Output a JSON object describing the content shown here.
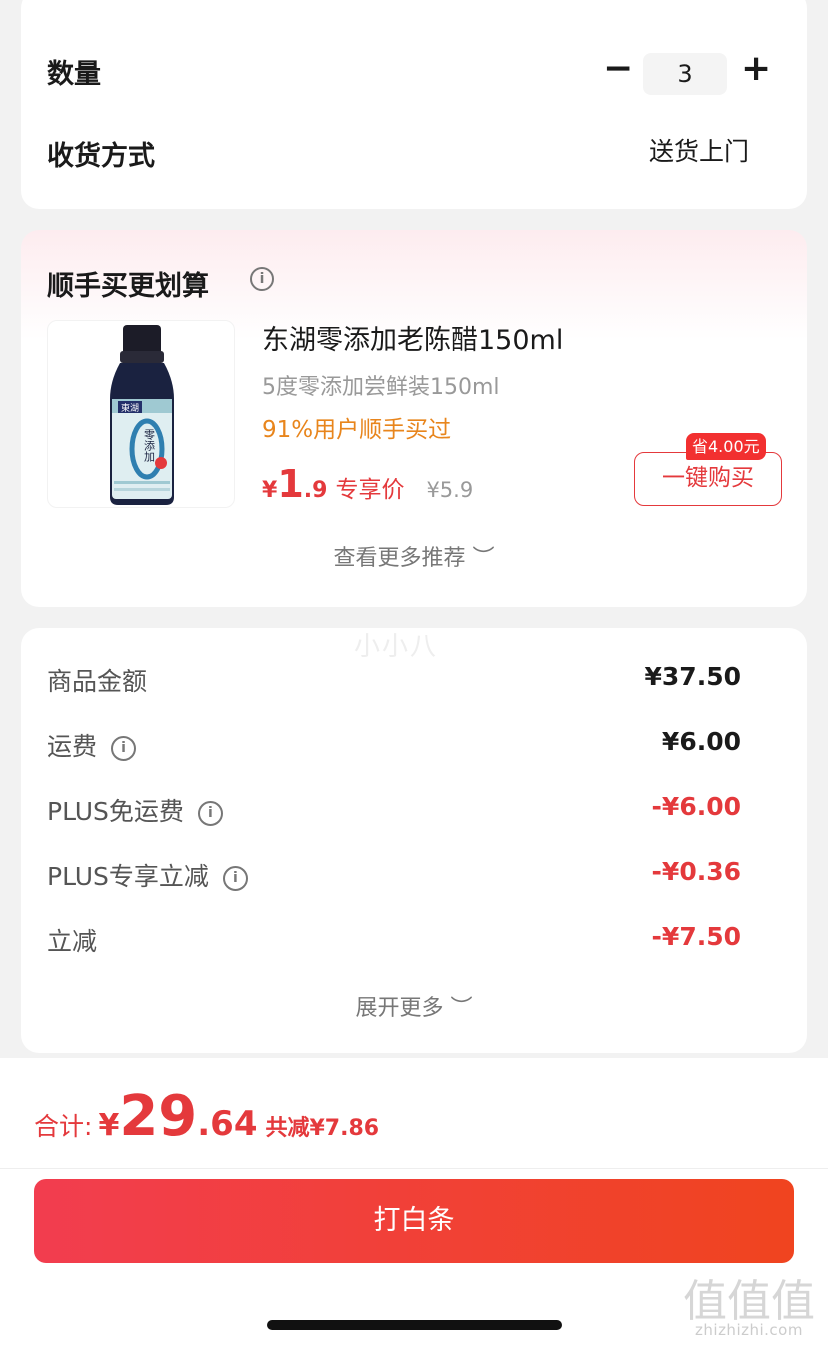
{
  "order": {
    "qty_label": "数量",
    "qty_minus": "−",
    "qty_value": "3",
    "qty_plus": "+",
    "delivery_label": "收货方式",
    "delivery_value": "送货上门"
  },
  "recommend": {
    "title": "顺手买更划算",
    "product": {
      "name": "东湖零添加老陈醋150ml",
      "spec": "5度零添加尝鲜装150ml",
      "buyers": "91%用户顺手买过",
      "currency": "¥",
      "price_int": "1",
      "price_dec": ".9",
      "price_tag": "专享价",
      "original_price": "¥5.9",
      "save_badge": "省4.00元",
      "buy_label": "一键购买",
      "image": {
        "brand": "東湖",
        "label": "零添加"
      }
    },
    "more_label": "查看更多推荐 ︶"
  },
  "breakdown": {
    "watermark": "小小八",
    "rows": [
      {
        "label": "商品金额",
        "value": "¥37.50"
      },
      {
        "label": "运费",
        "value": "¥6.00"
      },
      {
        "label": "PLUS免运费",
        "value": "-¥6.00"
      },
      {
        "label": "PLUS专享立减",
        "value": "-¥0.36"
      },
      {
        "label": "立减",
        "value": "-¥7.50"
      }
    ],
    "expand_label": "展开更多 ︶"
  },
  "footer": {
    "total_label": "合计:",
    "total_currency": "¥",
    "total_int": "29",
    "total_dec": ".64",
    "total_saved": "共减¥7.86",
    "pay_label": "打白条",
    "logo_mark": "值值值",
    "logo_text": "zhizhizhi.com"
  },
  "colors": {
    "accent_red": "#e4393c",
    "orange": "#e8851c",
    "pay_gradient_start": "#f23d4f",
    "pay_gradient_end": "#f0441f"
  }
}
